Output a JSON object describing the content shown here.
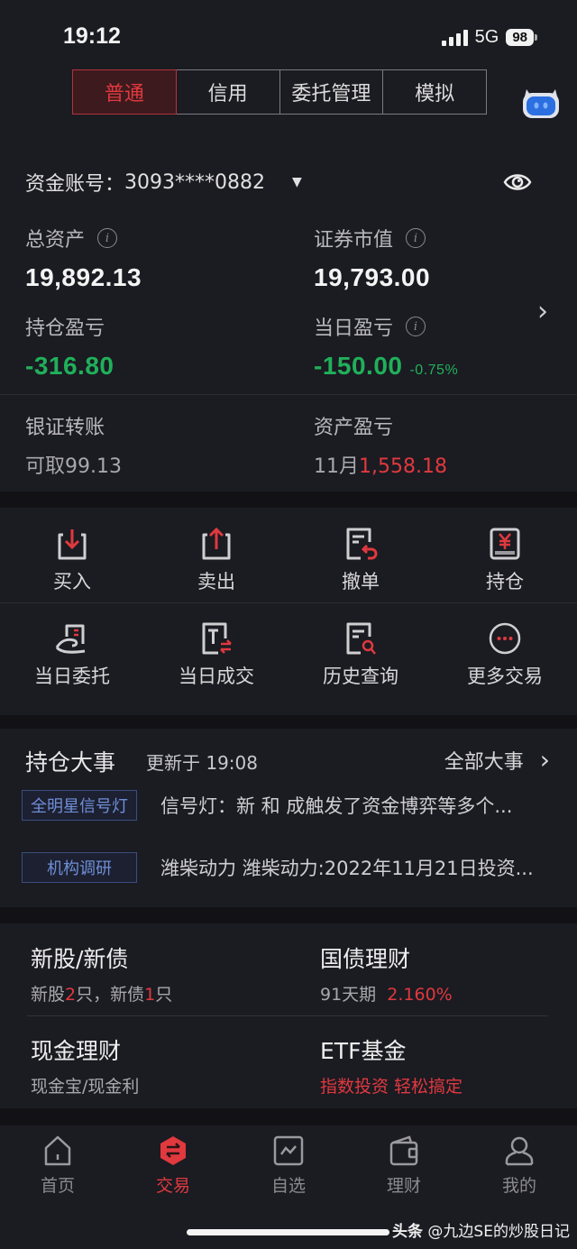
{
  "status_bar": {
    "time": "19:12",
    "network": "5G",
    "battery": "98"
  },
  "mode_tabs": [
    {
      "label": "普通",
      "active": true
    },
    {
      "label": "信用",
      "active": false
    },
    {
      "label": "委托管理",
      "active": false
    },
    {
      "label": "模拟",
      "active": false
    }
  ],
  "account": {
    "label": "资金账号：",
    "number": "3093****0882",
    "dropdown_icon": "▼"
  },
  "metrics": {
    "total_assets": {
      "label": "总资产",
      "value": "19,892.13"
    },
    "market_value": {
      "label": "证券市值",
      "value": "19,793.00"
    },
    "position_pnl": {
      "label": "持仓盈亏",
      "value": "-316.80"
    },
    "daily_pnl": {
      "label": "当日盈亏",
      "value": "-150.00",
      "percent": "-0.75%"
    }
  },
  "transfer": {
    "label": "银证转账",
    "value_prefix": "可取",
    "value": "99.13"
  },
  "asset_pnl": {
    "label": "资产盈亏",
    "month": "11月",
    "value": "1,558.18"
  },
  "actions": [
    {
      "label": "买入",
      "icon": "buy-icon"
    },
    {
      "label": "卖出",
      "icon": "sell-icon"
    },
    {
      "label": "撤单",
      "icon": "cancel-order-icon"
    },
    {
      "label": "持仓",
      "icon": "position-icon"
    },
    {
      "label": "当日委托",
      "icon": "daily-order-icon"
    },
    {
      "label": "当日成交",
      "icon": "daily-trade-icon"
    },
    {
      "label": "历史查询",
      "icon": "history-search-icon"
    },
    {
      "label": "更多交易",
      "icon": "more-icon"
    }
  ],
  "events": {
    "title": "持仓大事",
    "updated": "更新于 19:08",
    "all_label": "全部大事",
    "items": [
      {
        "tag": "全明星信号灯",
        "text": "信号灯：新 和 成触发了资金博弈等多个..."
      },
      {
        "tag": "机构调研",
        "text": "潍柴动力 潍柴动力:2022年11月21日投资..."
      }
    ]
  },
  "products": {
    "ipo": {
      "title": "新股/新债",
      "sub_a": "新股",
      "count_a": "2",
      "sub_b": "只，新债",
      "count_b": "1",
      "sub_c": "只"
    },
    "treasury": {
      "title": "国债理财",
      "term": "91天期",
      "rate": "2.160%"
    },
    "cash": {
      "title": "现金理财",
      "sub": "现金宝/现金利"
    },
    "etf": {
      "title": "ETF基金",
      "sub": "指数投资 轻松搞定"
    }
  },
  "tabbar": [
    {
      "label": "首页",
      "active": false
    },
    {
      "label": "交易",
      "active": true
    },
    {
      "label": "自选",
      "active": false
    },
    {
      "label": "理财",
      "active": false
    },
    {
      "label": "我的",
      "active": false
    }
  ],
  "watermark": {
    "brand": "头条",
    "author": "@九边SE的炒股日记"
  },
  "colors": {
    "accent_red": "#e0393e",
    "gain_green": "#20b05a",
    "tag_blue": "#6f8ed8",
    "background": "#1b1b22"
  }
}
